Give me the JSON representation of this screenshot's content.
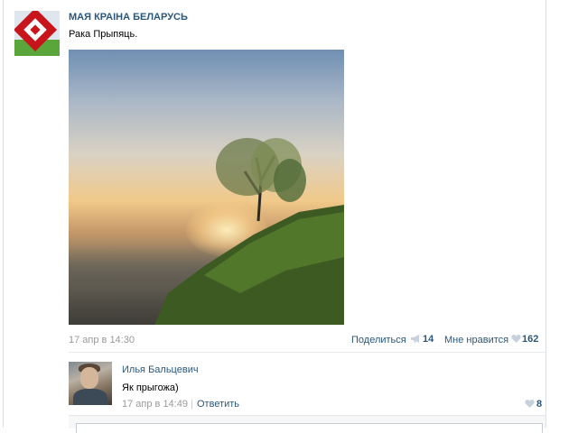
{
  "post": {
    "group_name": "МАЯ КРАІНА БЕЛАРУСЬ",
    "text": "Рака Прыпяць.",
    "date": "17 апр в 14:30",
    "share_label": "Поделиться",
    "share_count": "14",
    "like_label": "Мне нравится",
    "like_count": "162"
  },
  "comment": {
    "author": "Илья Бальцевич",
    "text": "Як прыгожа)",
    "date": "17 апр в 14:49",
    "separator": "|",
    "reply_label": "Ответить",
    "like_count": "8"
  },
  "icons": {
    "share": "megaphone-icon",
    "like": "heart-icon"
  },
  "colors": {
    "link": "#2b587a",
    "meta": "#999999",
    "icon": "#c5d2de"
  }
}
